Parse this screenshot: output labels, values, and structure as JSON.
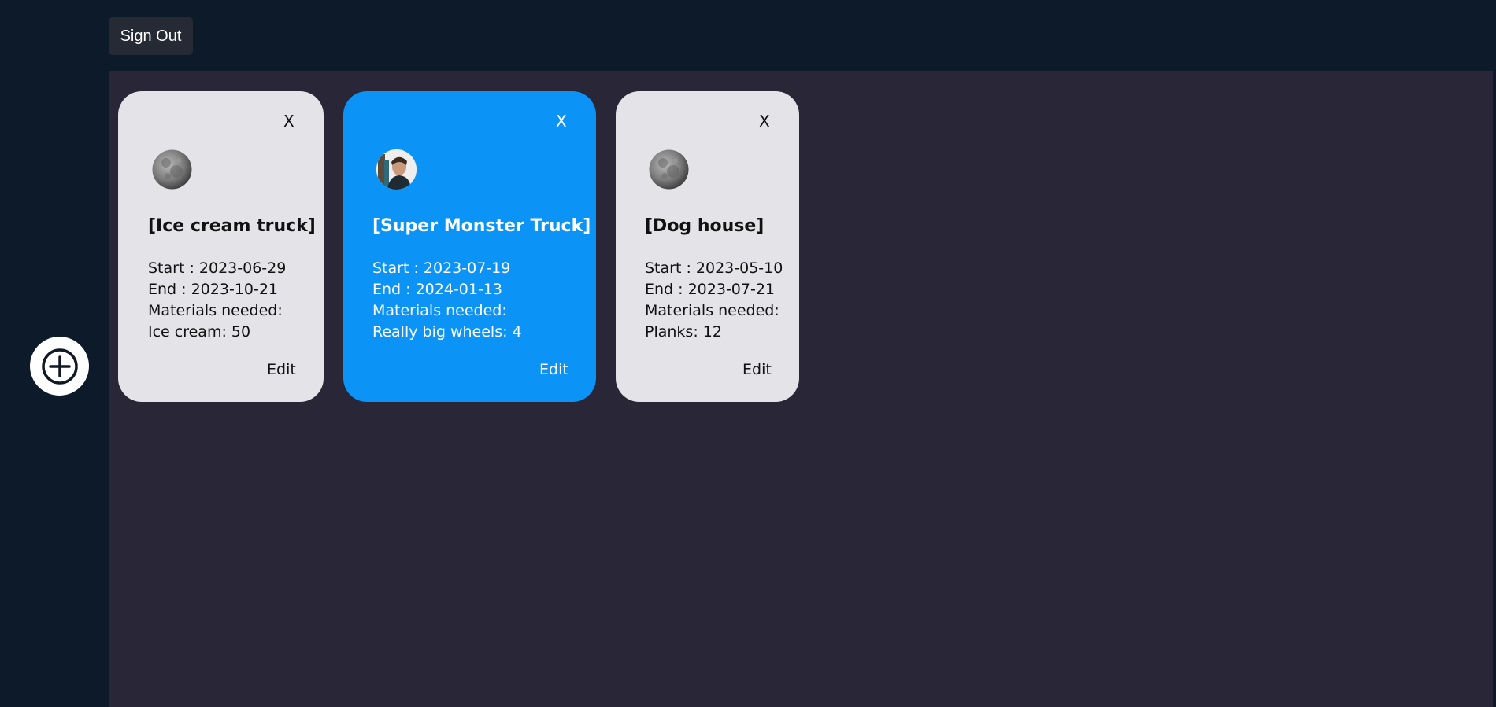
{
  "header": {
    "sign_out_label": "Sign Out"
  },
  "sidebar": {
    "add_icon": "plus-icon"
  },
  "cards": [
    {
      "close_label": "X",
      "avatar": "moon-avatar",
      "title": "[Ice cream truck]",
      "start": "Start : 2023-06-29",
      "end": "End : 2023-10-21",
      "materials_heading": "Materials needed:",
      "material": "Ice cream: 50",
      "edit_label": "Edit",
      "background": "#e4e3e8"
    },
    {
      "close_label": "X",
      "avatar": "person-avatar",
      "title": "[Super Monster Truck]",
      "start": "Start : 2023-07-19",
      "end": "End : 2024-01-13",
      "materials_heading": "Materials needed:",
      "material": "Really big wheels: 4",
      "edit_label": "Edit",
      "background": "#0b93f6"
    },
    {
      "close_label": "X",
      "avatar": "moon-avatar",
      "title": "[Dog house]",
      "start": "Start : 2023-05-10",
      "end": "End : 2023-07-21",
      "materials_heading": "Materials needed:",
      "material": "Planks: 12",
      "edit_label": "Edit",
      "background": "#e4e3e8"
    }
  ]
}
